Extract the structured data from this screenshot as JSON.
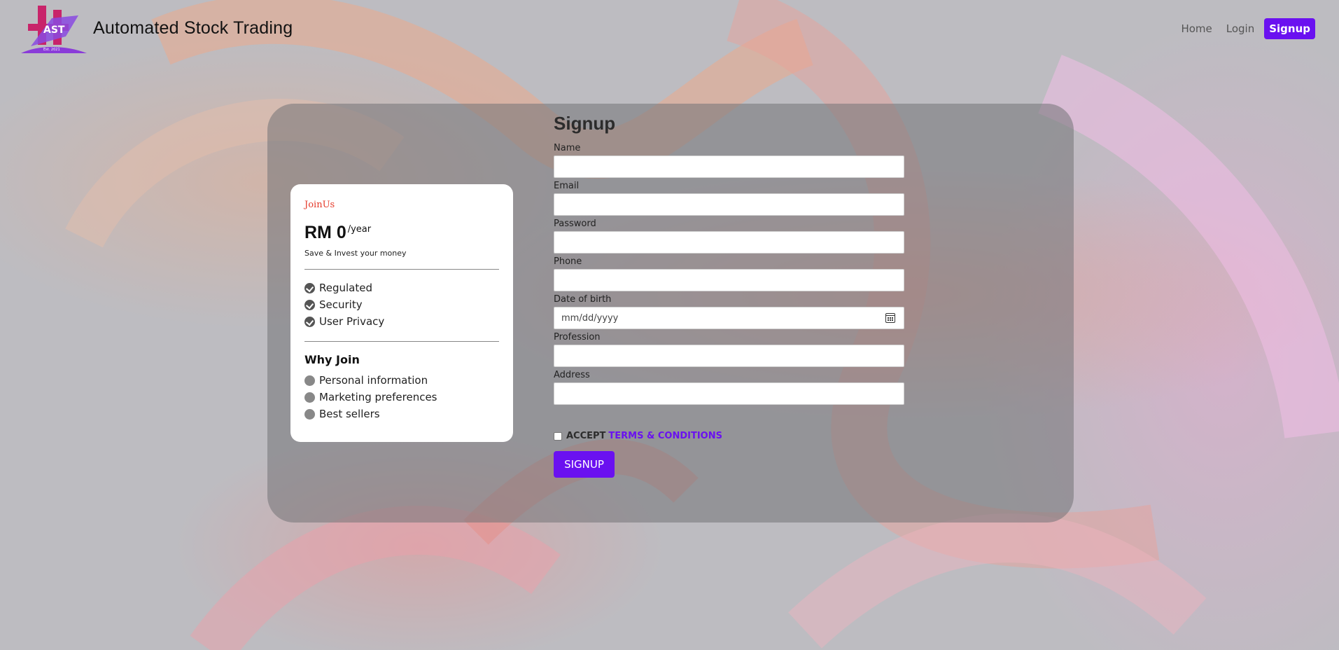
{
  "header": {
    "brand": "Automated Stock Trading",
    "logo_text": "AST",
    "logo_sub": "Est. 2021",
    "nav": {
      "home": "Home",
      "login": "Login",
      "signup": "Signup"
    }
  },
  "pricing": {
    "tag": "JoinUs",
    "amount": "RM 0",
    "period": "/year",
    "subtitle": "Save & Invest your money",
    "features": [
      "Regulated",
      "Security",
      "User Privacy"
    ],
    "why_title": "Why Join",
    "reasons": [
      "Personal information",
      "Marketing preferences",
      "Best sellers"
    ]
  },
  "form": {
    "title": "Signup",
    "fields": {
      "name": "Name",
      "email": "Email",
      "password": "Password",
      "phone": "Phone",
      "dob": "Date of birth",
      "dob_placeholder": "mm/dd/yyyy",
      "profession": "Profession",
      "address": "Address"
    },
    "accept": "ACCEPT",
    "terms": "TERMS & CONDITIONS",
    "submit": "SIGNUP"
  },
  "colors": {
    "accent": "#6a11f0",
    "tag": "#e53a2a"
  },
  "icons": [
    "logo-icon",
    "check-circle-icon",
    "circle-icon",
    "calendar-icon"
  ]
}
